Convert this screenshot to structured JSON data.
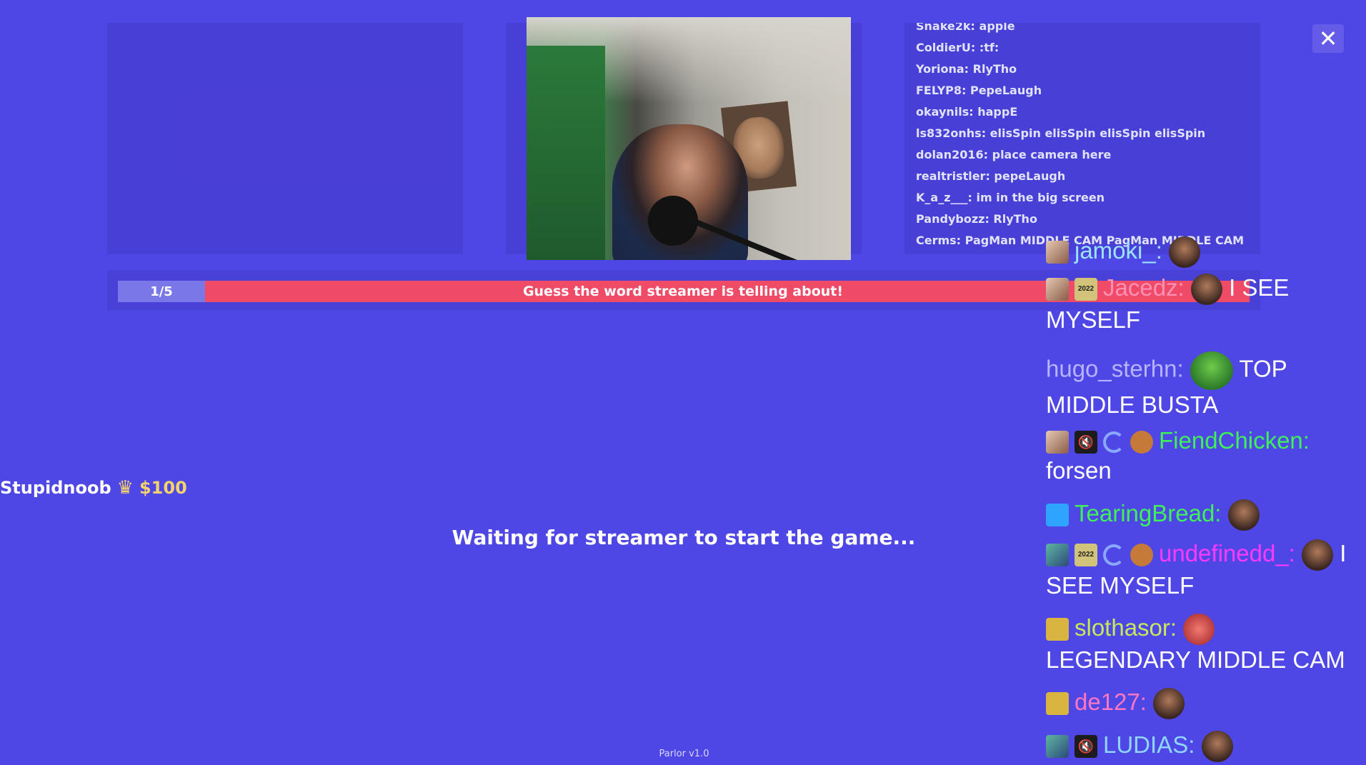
{
  "small_chat": [
    "Snake2k: apple",
    "ColdierU: :tf:",
    "Yoriona: RlyTho",
    "FELYP8: PepeLaugh",
    "okaynils: happE",
    "ls832onhs: elisSpin elisSpin elisSpin elisSpin",
    "dolan2016: place camera here",
    "realtristler: pepeLaugh",
    "K_a_z___: im in the big screen",
    "Pandybozz: RlyTho",
    "Cerms: PagMan MIDDLE CAM PagMan MIDDLE CAM"
  ],
  "round": {
    "counter": "1/5",
    "prompt": "Guess the word streamer is telling about!"
  },
  "player": {
    "name": "Stupidnoob",
    "money": "$100"
  },
  "waiting": "Waiting for streamer to start the game...",
  "version": "Parlor v1.0",
  "colors": {
    "background": "#4f46e6",
    "prompt_bar": "#ef4b67",
    "money": "#f3d36b"
  },
  "big_chat": [
    {
      "user": "jamoki_:",
      "user_color": "#9be3ff",
      "text": ""
    },
    {
      "user": "Jacedz:",
      "user_color": "#ff8fb4",
      "text": "I SEE MYSELF"
    },
    {
      "user": "hugo_sterhn:",
      "user_color": "#b6b3ff",
      "text": "TOP MIDDLE BUSTA"
    },
    {
      "user": "FiendChicken:",
      "user_color": "#3ef05a",
      "text": "forsen"
    },
    {
      "user": "TearingBread:",
      "user_color": "#3ef05a",
      "text": ""
    },
    {
      "user": "undefinedd_:",
      "user_color": "#ff3aff",
      "text": "I SEE MYSELF"
    },
    {
      "user": "slothasor:",
      "user_color": "#c7e85a",
      "text": "LEGENDARY MIDDLE CAM"
    },
    {
      "user": "de127:",
      "user_color": "#ff77c1",
      "text": ""
    },
    {
      "user": "LUDIAS:",
      "user_color": "#8fd6ff",
      "text": ""
    }
  ]
}
